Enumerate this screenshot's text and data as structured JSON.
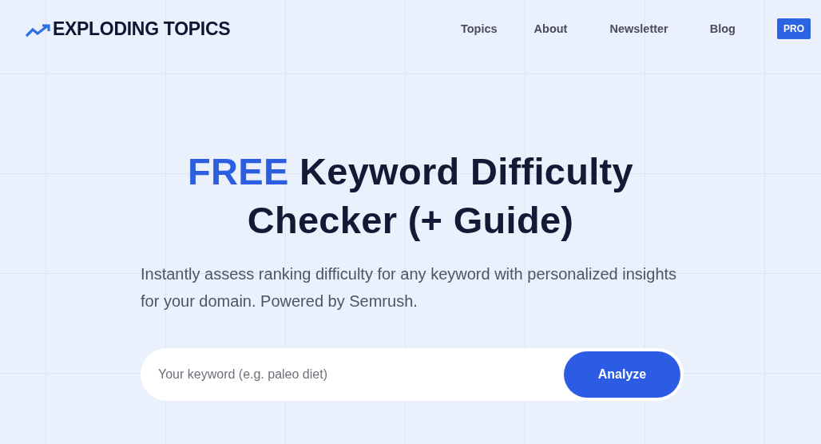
{
  "header": {
    "logo": "EXPLODING TOPICS",
    "nav": [
      {
        "label": "Topics"
      },
      {
        "label": "About"
      },
      {
        "label": "Newsletter"
      },
      {
        "label": "Blog"
      }
    ],
    "pro_badge": "PRO"
  },
  "hero": {
    "title": "**FREE** Keyword Difficulty Checker (+ Guide)",
    "subtitle": "Instantly assess ranking difficulty for any keyword with personalized insights for your domain. Powered by Semrush."
  },
  "search": {
    "placeholder": "Your keyword (e.g. paleo diet)",
    "button": "Analyze"
  }
}
